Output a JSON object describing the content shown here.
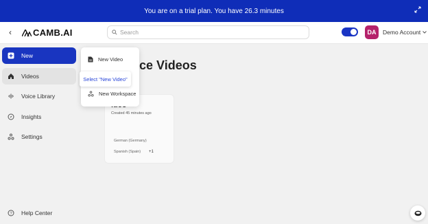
{
  "banner": {
    "text": "You are on a trial plan. You have 26.3 minutes"
  },
  "topbar": {
    "logo_text": "CAMB.AI",
    "search_placeholder": "Search",
    "avatar_initials": "DA",
    "account_label": "Demo Account",
    "brand_color": "#1935c0"
  },
  "sidebar": {
    "items": [
      {
        "label": "New",
        "icon": "plus-square-icon"
      },
      {
        "label": "Videos",
        "icon": "home-icon"
      },
      {
        "label": "Voice Library",
        "icon": "waveform-icon"
      },
      {
        "label": "Insights",
        "icon": "compass-icon"
      },
      {
        "label": "Settings",
        "icon": "nodes-icon"
      }
    ],
    "help_label": "Help Center"
  },
  "main": {
    "title": "pace Videos",
    "card": {
      "title": "ideo",
      "created": "Created 45 minutes ago",
      "languages": [
        "German (Germany)",
        "Spanish (Spain)"
      ],
      "more": "+1"
    }
  },
  "menu": {
    "items": [
      {
        "label": "New Video",
        "icon": "document-icon"
      },
      {
        "label": "New Workspace",
        "icon": "workspace-icon"
      }
    ]
  },
  "hint": {
    "text": "Select \"New Video\""
  }
}
